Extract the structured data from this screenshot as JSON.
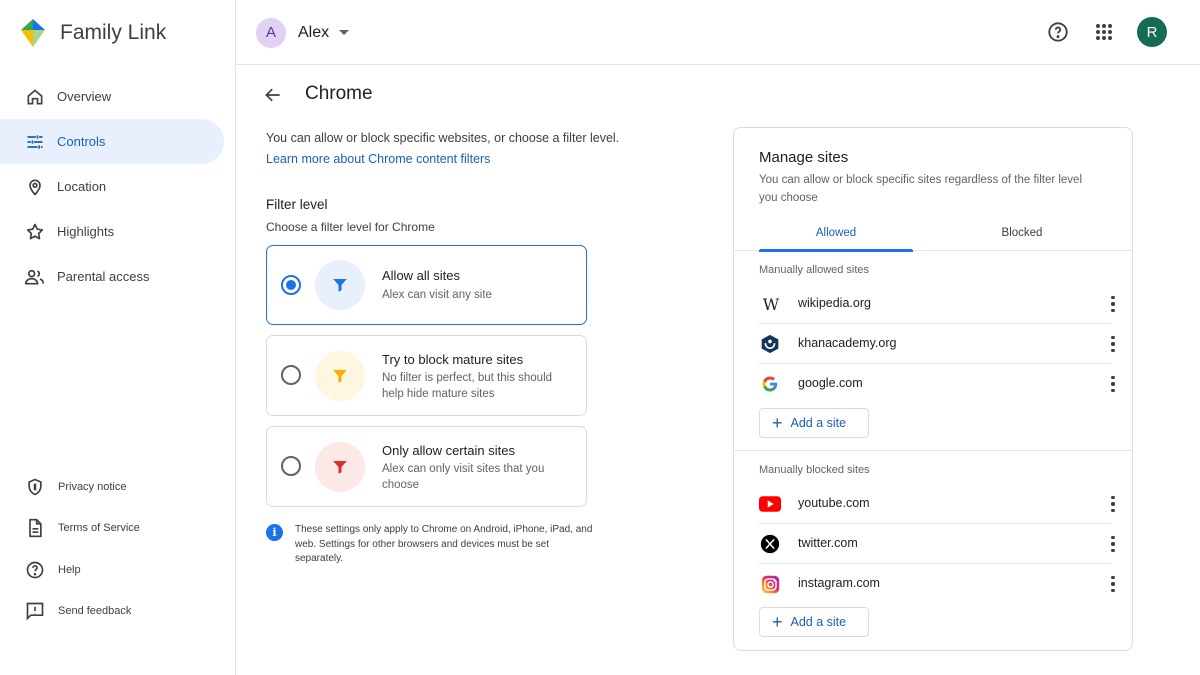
{
  "app": {
    "name": "Family Link"
  },
  "sidebar": {
    "items": [
      {
        "label": "Overview",
        "icon": "home-icon"
      },
      {
        "label": "Controls",
        "icon": "tune-icon"
      },
      {
        "label": "Location",
        "icon": "location-pin-icon"
      },
      {
        "label": "Highlights",
        "icon": "star-icon"
      },
      {
        "label": "Parental access",
        "icon": "people-icon"
      }
    ],
    "active": "Controls",
    "footer": [
      {
        "label": "Privacy notice",
        "icon": "shield-icon"
      },
      {
        "label": "Terms of Service",
        "icon": "document-icon"
      },
      {
        "label": "Help",
        "icon": "help-icon"
      },
      {
        "label": "Send feedback",
        "icon": "feedback-icon"
      }
    ]
  },
  "header": {
    "child_initial": "A",
    "child_name": "Alex",
    "account_initial": "R"
  },
  "page": {
    "title": "Chrome",
    "intro": "You can allow or block specific websites, or choose a filter level.",
    "learn_more": "Learn more about Chrome content filters",
    "filter_title": "Filter level",
    "filter_subtitle": "Choose a filter level for Chrome",
    "options": [
      {
        "title": "Allow all sites",
        "desc": "Alex can visit any site",
        "selected": true,
        "color": "#1a73e8",
        "bg": "#e8f0fe"
      },
      {
        "title": "Try to block mature sites",
        "desc": "No filter is perfect, but this should help hide mature sites",
        "selected": false,
        "color": "#f9ab00",
        "bg": "#fef7e0"
      },
      {
        "title": "Only allow certain sites",
        "desc": "Alex can only visit sites that you choose",
        "selected": false,
        "color": "#d93025",
        "bg": "#fce8e6"
      }
    ],
    "note": "These settings only apply to Chrome on Android, iPhone, iPad, and web. Settings for other browsers and devices must be set separately."
  },
  "manage": {
    "title": "Manage sites",
    "subtitle": "You can allow or block specific sites regardless of the filter level you choose",
    "tabs": [
      "Allowed",
      "Blocked"
    ],
    "active_tab": "Allowed",
    "allowed_label": "Manually allowed sites",
    "allowed": [
      {
        "name": "wikipedia.org",
        "icon": "wikipedia-icon"
      },
      {
        "name": "khanacademy.org",
        "icon": "khan-academy-icon"
      },
      {
        "name": "google.com",
        "icon": "google-icon"
      }
    ],
    "blocked_label": "Manually blocked sites",
    "blocked": [
      {
        "name": "youtube.com",
        "icon": "youtube-icon"
      },
      {
        "name": "twitter.com",
        "icon": "x-icon"
      },
      {
        "name": "instagram.com",
        "icon": "instagram-icon"
      }
    ],
    "add_label": "Add a site"
  }
}
